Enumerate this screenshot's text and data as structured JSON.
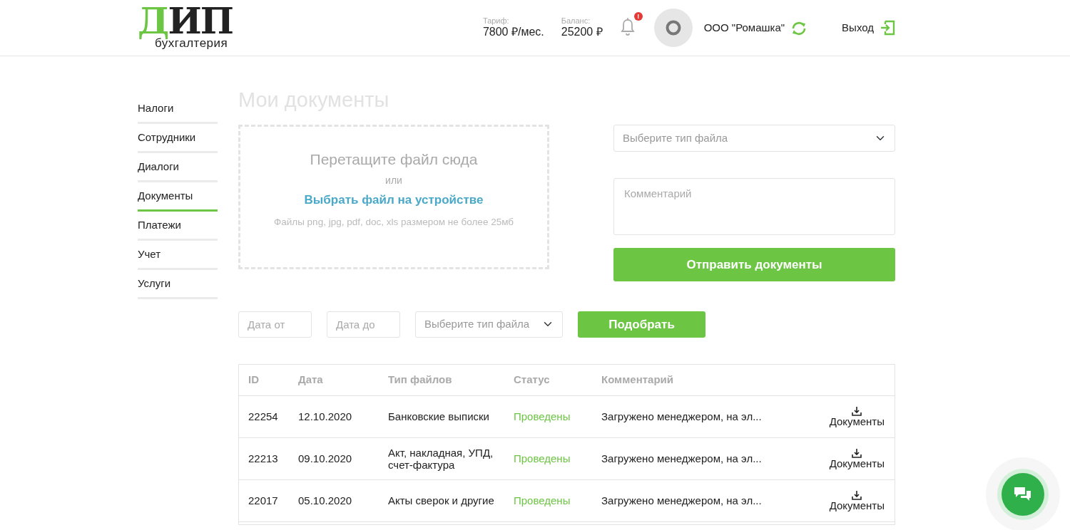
{
  "logo": {
    "accent": "Д",
    "main": "ИП",
    "subtitle": "бухгалтерия"
  },
  "header": {
    "stats": [
      {
        "label": "Тариф:",
        "value": "7800 ₽/мес."
      },
      {
        "label": "Баланс:",
        "value": "25200 ₽"
      }
    ],
    "notification_badge": "!",
    "company": "ООО \"Ромашка\"",
    "logout": "Выход"
  },
  "sidebar": {
    "items": [
      {
        "label": "Налоги",
        "selected": false
      },
      {
        "label": "Сотрудники",
        "selected": false
      },
      {
        "label": "Диалоги",
        "selected": false
      },
      {
        "label": "Документы",
        "selected": true
      },
      {
        "label": "Платежи",
        "selected": false
      },
      {
        "label": "Учет",
        "selected": false
      },
      {
        "label": "Услуги",
        "selected": false
      }
    ]
  },
  "page_title": "Мои документы",
  "upload": {
    "drop_text": "Перетащите файл сюда",
    "or": "или",
    "choose_link": "Выбрать файл на устройстве",
    "hint": "Файлы png, jpg, pdf, doc, xls размером не более 25мб"
  },
  "form": {
    "file_type_placeholder": "Выберите тип файла",
    "comment_placeholder": "Комментарий",
    "submit": "Отправить документы"
  },
  "filters": {
    "date_from_placeholder": "Дата от",
    "date_to_placeholder": "Дата до",
    "file_type_placeholder": "Выберите тип файла",
    "apply": "Подобрать"
  },
  "table": {
    "columns": [
      "ID",
      "Дата",
      "Тип файлов",
      "Статус",
      "Комментарий"
    ],
    "rows": [
      {
        "id": "22254",
        "date": "12.10.2020",
        "file_type": "Банковские выписки",
        "status": "Проведены",
        "comment": "Загружено менеджером, на эл...",
        "action": "Документы"
      },
      {
        "id": "22213",
        "date": "09.10.2020",
        "file_type": "Акт, накладная, УПД, счет-фактура",
        "status": "Проведены",
        "comment": "Загружено менеджером, на эл...",
        "action": "Документы"
      },
      {
        "id": "22017",
        "date": "05.10.2020",
        "file_type": "Акты сверок и другие",
        "status": "Проведены",
        "comment": "Загружено менеджером, на эл...",
        "action": "Документы"
      }
    ]
  }
}
